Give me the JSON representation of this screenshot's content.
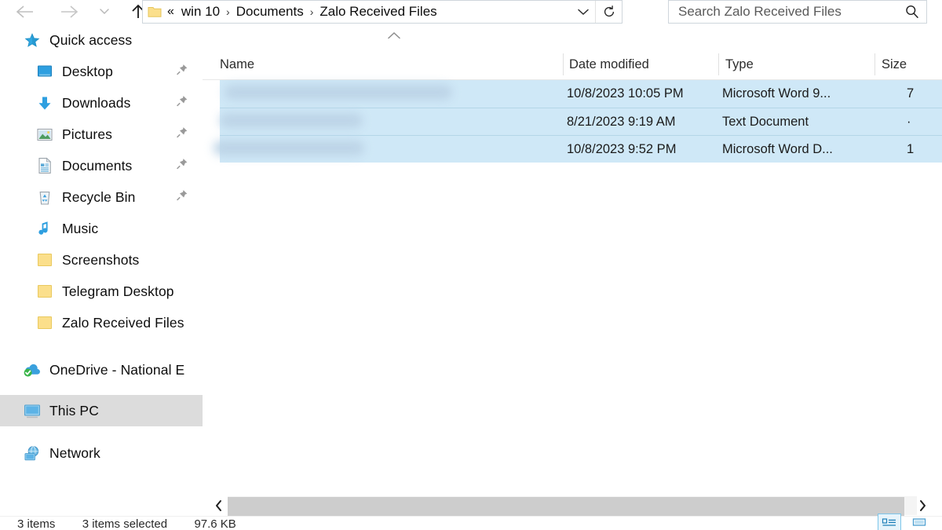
{
  "window": {
    "app": "File Explorer"
  },
  "toolbar": {
    "back_label": "Back",
    "forward_label": "Forward",
    "recent_label": "Recent locations",
    "up_label": "Up one level"
  },
  "address": {
    "lead": "«",
    "crumbs": [
      "win 10",
      "Documents",
      "Zalo Received Files"
    ],
    "separator": "›",
    "dropdown_label": "Previous locations",
    "refresh_label": "Refresh"
  },
  "search": {
    "placeholder": "Search Zalo Received Files",
    "value": ""
  },
  "sidebar": {
    "items": [
      {
        "label": "Quick access",
        "icon": "star-icon",
        "level": "root",
        "pinned": false,
        "selected": false
      },
      {
        "label": "Desktop",
        "icon": "desktop-icon",
        "level": "indent",
        "pinned": true,
        "selected": false
      },
      {
        "label": "Downloads",
        "icon": "download-icon",
        "level": "indent",
        "pinned": true,
        "selected": false
      },
      {
        "label": "Pictures",
        "icon": "pictures-icon",
        "level": "indent",
        "pinned": true,
        "selected": false
      },
      {
        "label": "Documents",
        "icon": "documents-icon",
        "level": "indent",
        "pinned": true,
        "selected": false
      },
      {
        "label": "Recycle Bin",
        "icon": "recycle-bin-icon",
        "level": "indent",
        "pinned": true,
        "selected": false
      },
      {
        "label": "Music",
        "icon": "music-icon",
        "level": "indent",
        "pinned": false,
        "selected": false
      },
      {
        "label": "Screenshots",
        "icon": "folder-icon",
        "level": "indent",
        "pinned": false,
        "selected": false
      },
      {
        "label": "Telegram Desktop",
        "icon": "folder-icon",
        "level": "indent",
        "pinned": false,
        "selected": false
      },
      {
        "label": "Zalo Received Files",
        "icon": "folder-icon",
        "level": "indent",
        "pinned": false,
        "selected": false
      },
      {
        "label": "OneDrive - National E",
        "icon": "onedrive-icon",
        "level": "root",
        "pinned": false,
        "selected": false
      },
      {
        "label": "This PC",
        "icon": "this-pc-icon",
        "level": "root",
        "pinned": false,
        "selected": true
      },
      {
        "label": "Network",
        "icon": "network-icon",
        "level": "root",
        "pinned": false,
        "selected": false
      }
    ]
  },
  "filelist": {
    "sort_column": "Name",
    "sort_direction": "ascending",
    "columns": [
      {
        "key": "name",
        "label": "Name"
      },
      {
        "key": "date",
        "label": "Date modified"
      },
      {
        "key": "type",
        "label": "Type"
      },
      {
        "key": "size",
        "label": "Size"
      }
    ],
    "rows": [
      {
        "name": "",
        "name_redacted": true,
        "date": "10/8/2023 10:05 PM",
        "type": "Microsoft Word 9...",
        "size": "7",
        "selected": true
      },
      {
        "name": "",
        "name_redacted": true,
        "date": "8/21/2023 9:19 AM",
        "type": "Text Document",
        "size": "·",
        "selected": true
      },
      {
        "name": "",
        "name_redacted": true,
        "date": "10/8/2023 9:52 PM",
        "type": "Microsoft Word D...",
        "size": "1",
        "selected": true
      }
    ]
  },
  "scrollbar": {
    "left_label": "Scroll left",
    "right_label": "Scroll right"
  },
  "status": {
    "item_count": "3 items",
    "selection": "3 items selected",
    "size": "97.6 KB",
    "view_details_label": "Details view",
    "view_large_icons_label": "Large icons view"
  },
  "colors": {
    "selection_blue": "#cfe8f7",
    "selection_gray": "#dcdcdc",
    "folder_yellow": "#fbdf8b",
    "accent_blue": "#1e90d2"
  }
}
